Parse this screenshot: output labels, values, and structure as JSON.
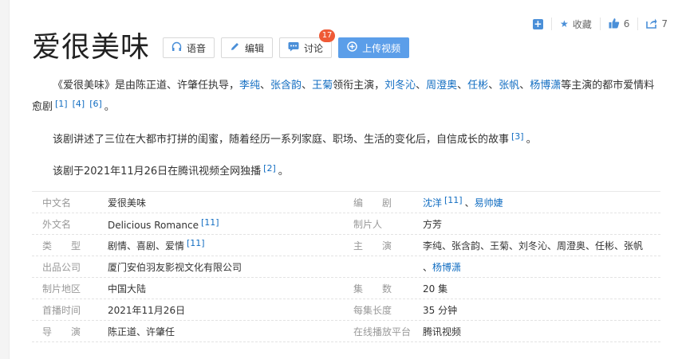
{
  "actions": {
    "add_label": "+",
    "favorite_label": "收藏",
    "like_count": "6",
    "share_count": "7"
  },
  "title": "爱很美味",
  "buttons": {
    "voice": "语音",
    "edit": "编辑",
    "discuss": "讨论",
    "discuss_badge": "17",
    "upload": "上传视频"
  },
  "intro": {
    "p1_a": "《爱很美味》是由陈正道、许肇任执导，",
    "cast_1": "李纯",
    "sep": "、",
    "cast_2": "张含韵",
    "cast_3": "王菊",
    "p1_b": "领衔主演，",
    "cast_4": "刘冬沁",
    "cast_5": "周澄奥",
    "cast_6": "任彬",
    "cast_7": "张帆",
    "cast_8": "杨博潇",
    "p1_c": "等主演的都市爱情料愈剧",
    "ref1": "[1]",
    "ref4": "[4]",
    "ref6": "[6]",
    "period": "。",
    "p2": "该剧讲述了三位在大都市打拼的闺蜜，随着经历一系列家庭、职场、生活的变化后，自信成长的故事",
    "ref3": "[3]",
    "p3": "该剧于2021年11月26日在腾讯视频全网独播",
    "ref2": "[2]"
  },
  "info": {
    "r1": {
      "k": "中文名",
      "v": "爱很美味",
      "k2": "编　　剧",
      "v2_link1": "沈洋",
      "v2_ref": "[11]",
      "v2_sep": "、",
      "v2_link2": "易帅婕"
    },
    "r2": {
      "k": "外文名",
      "v": "Delicious Romance",
      "v_ref": "[11]",
      "k2": "制片人",
      "v2": "方芳"
    },
    "r3": {
      "k": "类　　型",
      "v": "剧情、喜剧、爱情",
      "v_ref": "[11]",
      "k2": "主　　演",
      "v2": "李纯、张含韵、王菊、刘冬沁、周澄奥、任彬、张帆"
    },
    "r4": {
      "k": "出品公司",
      "v": "厦门安伯羽友影视文化有限公司",
      "v2_sep": "、",
      "v2_link": "杨博潇"
    },
    "r5": {
      "k": "制片地区",
      "v": "中国大陆",
      "k2": "集　　数",
      "v2": "20 集"
    },
    "r6": {
      "k": "首播时间",
      "v": "2021年11月26日",
      "k2": "每集长度",
      "v2": "35 分钟"
    },
    "r7": {
      "k": "导　　演",
      "v": "陈正道、许肇任",
      "k2": "在线播放平台",
      "v2": "腾讯视频"
    }
  }
}
